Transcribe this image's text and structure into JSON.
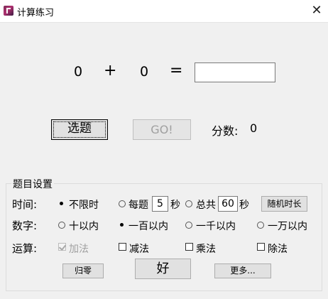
{
  "window": {
    "title": "计算练习",
    "close_glyph": "✕"
  },
  "equation": {
    "left": "0",
    "operator": "+",
    "right": "0",
    "equals": "=",
    "answer": ""
  },
  "actions": {
    "pick_label": "选题",
    "go_label": "GO!"
  },
  "score": {
    "label": "分数:",
    "value": "0"
  },
  "settings": {
    "group_title": "题目设置",
    "time": {
      "label": "时间:",
      "opt_unlimited": "不限时",
      "opt_per_question": "每题",
      "per_question_value": "5",
      "unit1": "秒",
      "opt_total": "总共",
      "total_value": "60",
      "unit2": "秒",
      "random_button": "随机时长",
      "selected": "不限时"
    },
    "number": {
      "label": "数字:",
      "options": [
        "十以内",
        "一百以内",
        "一千以内",
        "一万以内"
      ],
      "selected": "一百以内"
    },
    "operation": {
      "label": "运算:",
      "options": [
        "加法",
        "减法",
        "乘法",
        "除法"
      ],
      "checked": [
        "加法"
      ],
      "disabled": [
        "加法"
      ]
    },
    "buttons": {
      "reset": "归零",
      "ok": "好",
      "more": "更多..."
    }
  }
}
